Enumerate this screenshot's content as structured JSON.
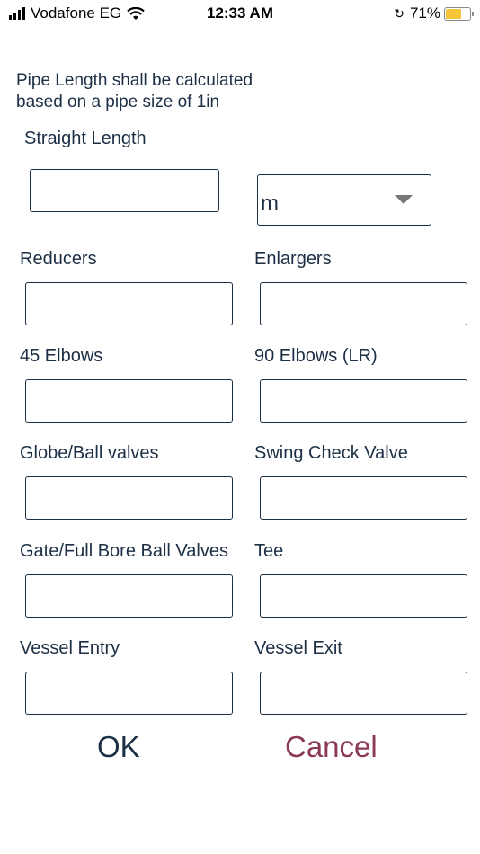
{
  "status_bar": {
    "carrier": "Vodafone EG",
    "time": "12:33 AM",
    "battery_percent": "71%",
    "battery_level": 0.71,
    "battery_color": "#f5c63a",
    "icons": [
      "signal-icon",
      "wifi-icon",
      "orientation-lock-icon",
      "battery-icon"
    ]
  },
  "info_text": {
    "line1": "Pipe Length shall be calculated",
    "line2": "based on a pipe size of 1in"
  },
  "form": {
    "straight_length": {
      "label": "Straight Length",
      "value": "",
      "unit": "m"
    },
    "reducers": {
      "label": "Reducers",
      "value": ""
    },
    "enlargers": {
      "label": "Enlargers",
      "value": ""
    },
    "elbows_45": {
      "label": "45 Elbows",
      "value": ""
    },
    "elbows_90": {
      "label": "90 Elbows (LR)",
      "value": ""
    },
    "globe_ball_valves": {
      "label": "Globe/Ball valves",
      "value": ""
    },
    "swing_check_valve": {
      "label": "Swing Check Valve",
      "value": ""
    },
    "gate_full_bore": {
      "label": "Gate/Full Bore Ball Valves",
      "value": ""
    },
    "tee": {
      "label": "Tee",
      "value": ""
    },
    "vessel_entry": {
      "label": "Vessel Entry",
      "value": ""
    },
    "vessel_exit": {
      "label": "Vessel Exit",
      "value": ""
    }
  },
  "actions": {
    "ok": "OK",
    "cancel": "Cancel"
  },
  "colors": {
    "text": "#1c2f45",
    "cancel": "#8a3a52",
    "border": "#1c2f45"
  }
}
